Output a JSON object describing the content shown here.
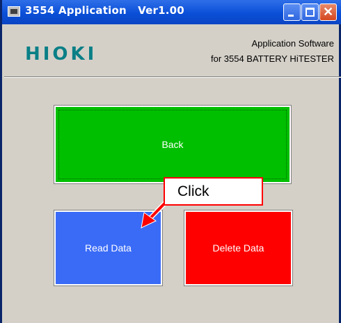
{
  "window": {
    "title": "3554 Application   Ver1.00",
    "controls": {
      "minimize": "minimize",
      "maximize": "maximize",
      "close": "✕"
    }
  },
  "header": {
    "logo": "HIOKI",
    "subtitle_line1": "Application Software",
    "subtitle_line2": "for 3554 BATTERY HiTESTER"
  },
  "buttons": {
    "back": "Back",
    "read_data": "Read Data",
    "delete_data": "Delete Data"
  },
  "annotation": {
    "callout_text": "Click",
    "color": "#ff0000"
  },
  "colors": {
    "titlebar": "#0a4fd8",
    "back": "#00bf00",
    "read": "#3a6bf7",
    "delete": "#ff0000",
    "logo": "#0a7f86"
  }
}
